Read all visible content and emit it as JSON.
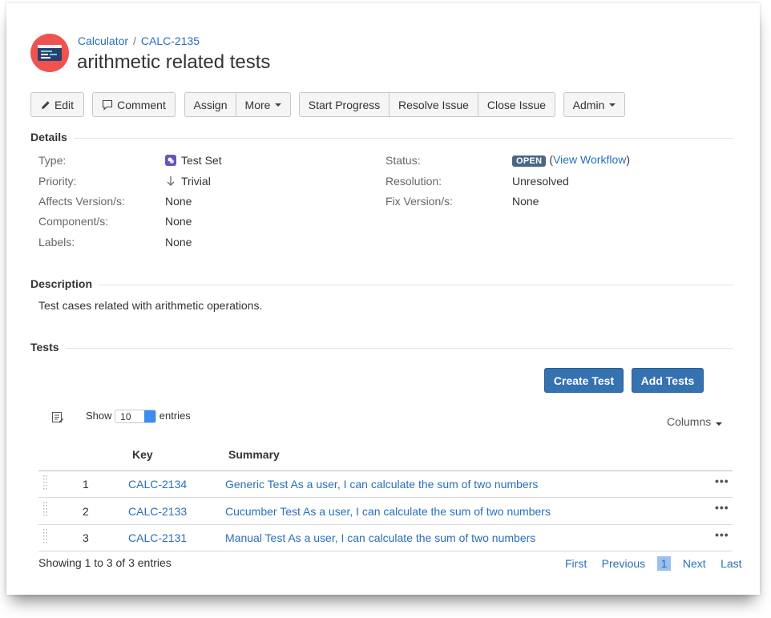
{
  "breadcrumb": {
    "project": "Calculator",
    "separator": "/",
    "issue_key": "CALC-2135"
  },
  "issue": {
    "title": "arithmetic related tests"
  },
  "toolbar": {
    "edit": "Edit",
    "comment": "Comment",
    "assign": "Assign",
    "more": "More",
    "start_progress": "Start Progress",
    "resolve_issue": "Resolve Issue",
    "close_issue": "Close Issue",
    "admin": "Admin"
  },
  "details": {
    "heading": "Details",
    "type_label": "Type:",
    "type_value": "Test Set",
    "priority_label": "Priority:",
    "priority_value": "Trivial",
    "affects_label": "Affects Version/s:",
    "affects_value": "None",
    "component_label": "Component/s:",
    "component_value": "None",
    "labels_label": "Labels:",
    "labels_value": "None",
    "status_label": "Status:",
    "status_value": "OPEN",
    "status_link": "View Workflow",
    "status_paren_open": "(",
    "status_paren_close": ")",
    "resolution_label": "Resolution:",
    "resolution_value": "Unresolved",
    "fix_label": "Fix Version/s:",
    "fix_value": "None"
  },
  "description": {
    "heading": "Description",
    "text": "Test cases related with arithmetic operations."
  },
  "tests": {
    "heading": "Tests",
    "create_test": "Create Test",
    "add_tests": "Add Tests",
    "show_label": "Show",
    "entries_value": "10",
    "entries_label": "entries",
    "columns_label": "Columns",
    "headers": {
      "key": "Key",
      "summary": "Summary"
    },
    "rows": [
      {
        "num": "1",
        "key": "CALC-2134",
        "summary": "Generic Test As a user, I can calculate the sum of two numbers"
      },
      {
        "num": "2",
        "key": "CALC-2133",
        "summary": "Cucumber Test As a user, I can calculate the sum of two numbers"
      },
      {
        "num": "3",
        "key": "CALC-2131",
        "summary": "Manual Test As a user, I can calculate the sum of two numbers"
      }
    ],
    "row_menu": "•••",
    "showing": "Showing 1 to 3 of 3 entries",
    "pager": {
      "first": "First",
      "previous": "Previous",
      "current": "1",
      "next": "Next",
      "last": "Last"
    }
  },
  "colors": {
    "link": "#2a6ebb",
    "primary": "#3572b0",
    "status_badge": "#4a6785",
    "avatar": "#ef5350"
  }
}
